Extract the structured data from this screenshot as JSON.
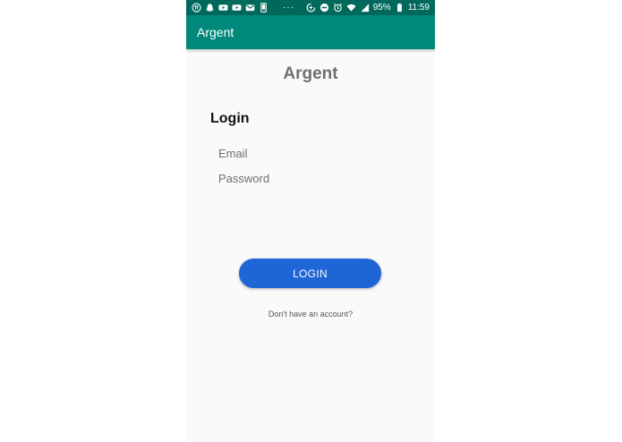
{
  "status_bar": {
    "left_icons": [
      "pi-icon",
      "snapchat-icon",
      "youtube-icon",
      "youtube-icon",
      "gmail-icon",
      "phone-device-icon"
    ],
    "overflow_dots": "···",
    "right_icons": [
      "data-saver-icon",
      "do-not-disturb-icon",
      "alarm-icon",
      "wifi-icon",
      "signal-icon"
    ],
    "battery_percent": "95%",
    "battery_icon": "battery-icon",
    "time": "11:59",
    "background_color": "#00695c"
  },
  "app_bar": {
    "title": "Argent",
    "background_color": "#00897b"
  },
  "main": {
    "brand_title": "Argent",
    "login_heading": "Login",
    "email": {
      "placeholder": "Email",
      "value": ""
    },
    "password": {
      "placeholder": "Password",
      "value": ""
    },
    "login_button_label": "LOGIN",
    "login_button_color": "#1e66d6",
    "signup_prompt": "Don't have an account?"
  }
}
